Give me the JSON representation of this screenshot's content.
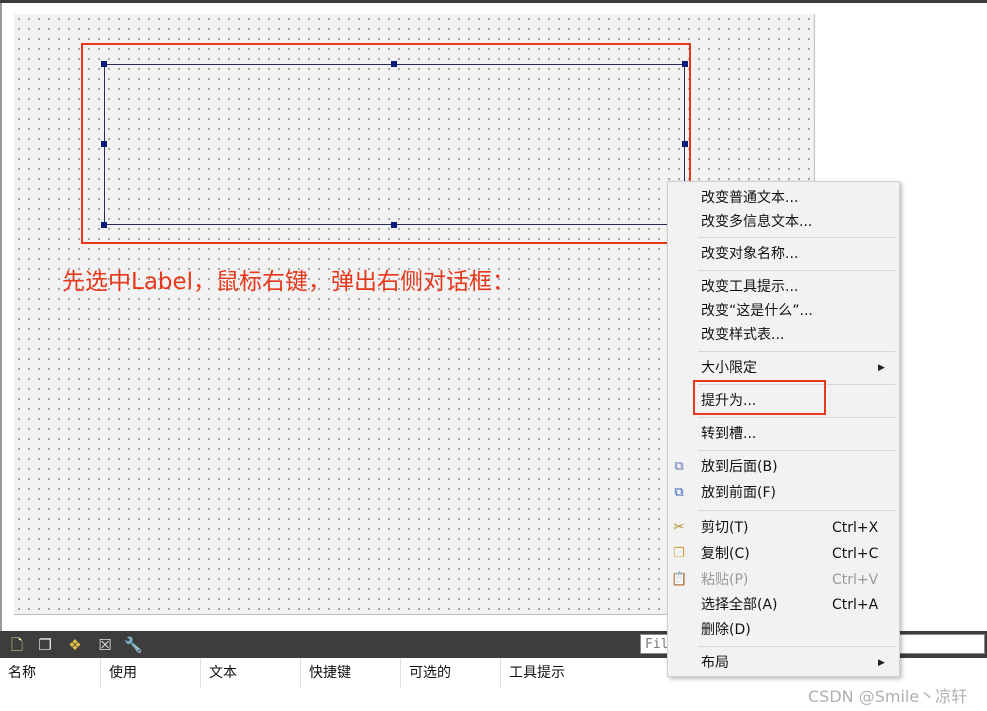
{
  "annotation": "先选中Label，鼠标右键，弹出右侧对话框：",
  "context_menu": {
    "items": [
      {
        "label": "改变普通文本..."
      },
      {
        "label": "改变多信息文本..."
      },
      {
        "label": "改变对象名称..."
      },
      {
        "label": "改变工具提示..."
      },
      {
        "label": "改变“这是什么”..."
      },
      {
        "label": "改变样式表..."
      },
      {
        "label": "大小限定",
        "submenu": true
      },
      {
        "label": "提升为..."
      },
      {
        "label": "转到槽..."
      },
      {
        "label": "放到后面(B)",
        "icon": "send-to-back-icon"
      },
      {
        "label": "放到前面(F)",
        "icon": "bring-to-front-icon"
      },
      {
        "label": "剪切(T)",
        "shortcut": "Ctrl+X",
        "icon": "scissors-icon"
      },
      {
        "label": "复制(C)",
        "shortcut": "Ctrl+C",
        "icon": "copy-icon"
      },
      {
        "label": "粘贴(P)",
        "shortcut": "Ctrl+V",
        "icon": "paste-icon",
        "disabled": true
      },
      {
        "label": "选择全部(A)",
        "shortcut": "Ctrl+A"
      },
      {
        "label": "删除(D)"
      },
      {
        "label": "布局",
        "submenu": true
      }
    ]
  },
  "filter": {
    "value": "Fil"
  },
  "action_table": {
    "columns": [
      "名称",
      "使用",
      "文本",
      "快捷键",
      "可选的",
      "工具提示"
    ]
  },
  "toolbar_icons": [
    "new-action-icon",
    "copy-icon",
    "python-icon",
    "delete-icon",
    "settings-wrench-icon"
  ],
  "watermark": "CSDN @Smile丶凉轩",
  "colors": {
    "annotation_red": "#e8381c",
    "selection_handle": "#0a1a7a"
  }
}
